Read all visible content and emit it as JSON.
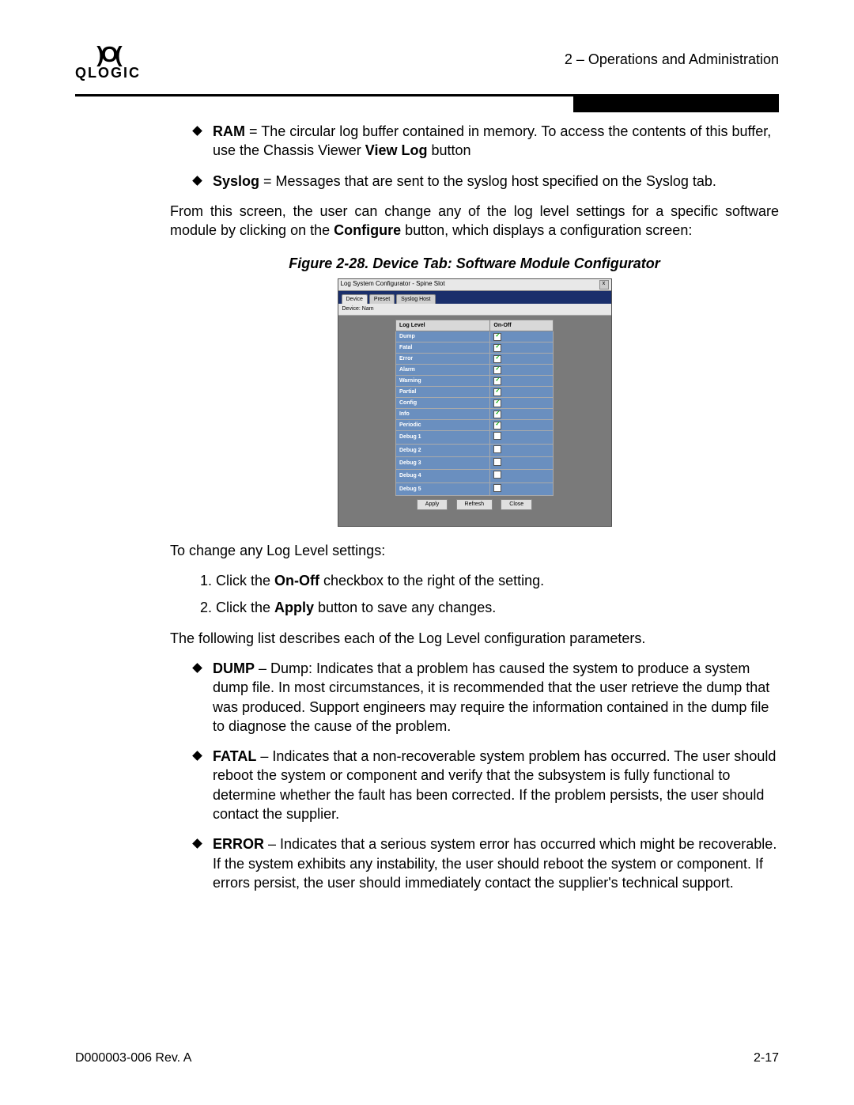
{
  "header": {
    "logo_text": "QLOGIC",
    "section_title": "2 – Operations and Administration"
  },
  "top_bullets": [
    {
      "term": "RAM",
      "sep": " = ",
      "pre": "The circular log buffer contained in memory. To access the contents of this buffer, use the Chassis Viewer ",
      "bold_inline": "View Log",
      "post": " button"
    },
    {
      "term": "Syslog",
      "sep": " = ",
      "pre": "Messages that are sent to the syslog host specified on the Syslog tab.",
      "bold_inline": "",
      "post": ""
    }
  ],
  "intro_para": {
    "pre": "From this screen, the user can change any of the log level settings for a specific software module by clicking on the ",
    "bold": "Configure",
    "post": " button, which displays a configuration screen:"
  },
  "figure": {
    "caption": "Figure 2-28. Device Tab: Software Module Configurator",
    "window_title": "Log System Configurator - Spine Slot",
    "close_glyph": "x",
    "tabs": {
      "active": "Device",
      "t2": "Preset",
      "t3": "Syslog Host"
    },
    "subhead": "Device: Nam",
    "col_level": "Log Level",
    "col_onoff": "On-Off",
    "rows": [
      {
        "label": "Dump",
        "checked": true
      },
      {
        "label": "Fatal",
        "checked": true
      },
      {
        "label": "Error",
        "checked": true
      },
      {
        "label": "Alarm",
        "checked": true
      },
      {
        "label": "Warning",
        "checked": true
      },
      {
        "label": "Partial",
        "checked": true
      },
      {
        "label": "Config",
        "checked": true
      },
      {
        "label": "Info",
        "checked": true
      },
      {
        "label": "Periodic",
        "checked": true
      },
      {
        "label": "Debug 1",
        "checked": false
      },
      {
        "label": "Debug 2",
        "checked": false
      },
      {
        "label": "Debug 3",
        "checked": false
      },
      {
        "label": "Debug 4",
        "checked": false
      },
      {
        "label": "Debug 5",
        "checked": false
      }
    ],
    "buttons": {
      "apply": "Apply",
      "refresh": "Refresh",
      "close": "Close"
    }
  },
  "steps_intro": "To change any Log Level settings:",
  "steps": [
    {
      "pre": "Click the ",
      "bold": "On-Off",
      "post": " checkbox to the right of the setting."
    },
    {
      "pre": "Click the ",
      "bold": "Apply",
      "post": " button to save any changes."
    }
  ],
  "param_intro": "The following list describes each of the Log Level configuration parameters.",
  "param_bullets": [
    {
      "term": "DUMP",
      "text": " – Dump: Indicates that a problem has caused the system to produce a system dump file. In most circumstances, it is recommended that the user retrieve the dump that was produced. Support engineers may require the information contained in the dump file to diagnose the cause of the problem."
    },
    {
      "term": "FATAL",
      "text": " – Indicates that a non-recoverable system problem has occurred. The user should reboot the system or component and verify that the subsystem is fully functional to determine whether the fault has been corrected. If the problem persists, the user should contact the supplier."
    },
    {
      "term": "ERROR",
      "text": " – Indicates that a serious system error has occurred which might be recoverable. If the system exhibits any instability, the user should reboot the system or component. If errors persist, the user should immediately contact the supplier's technical support."
    }
  ],
  "footer": {
    "left": "D000003-006 Rev. A",
    "right": "2-17"
  }
}
